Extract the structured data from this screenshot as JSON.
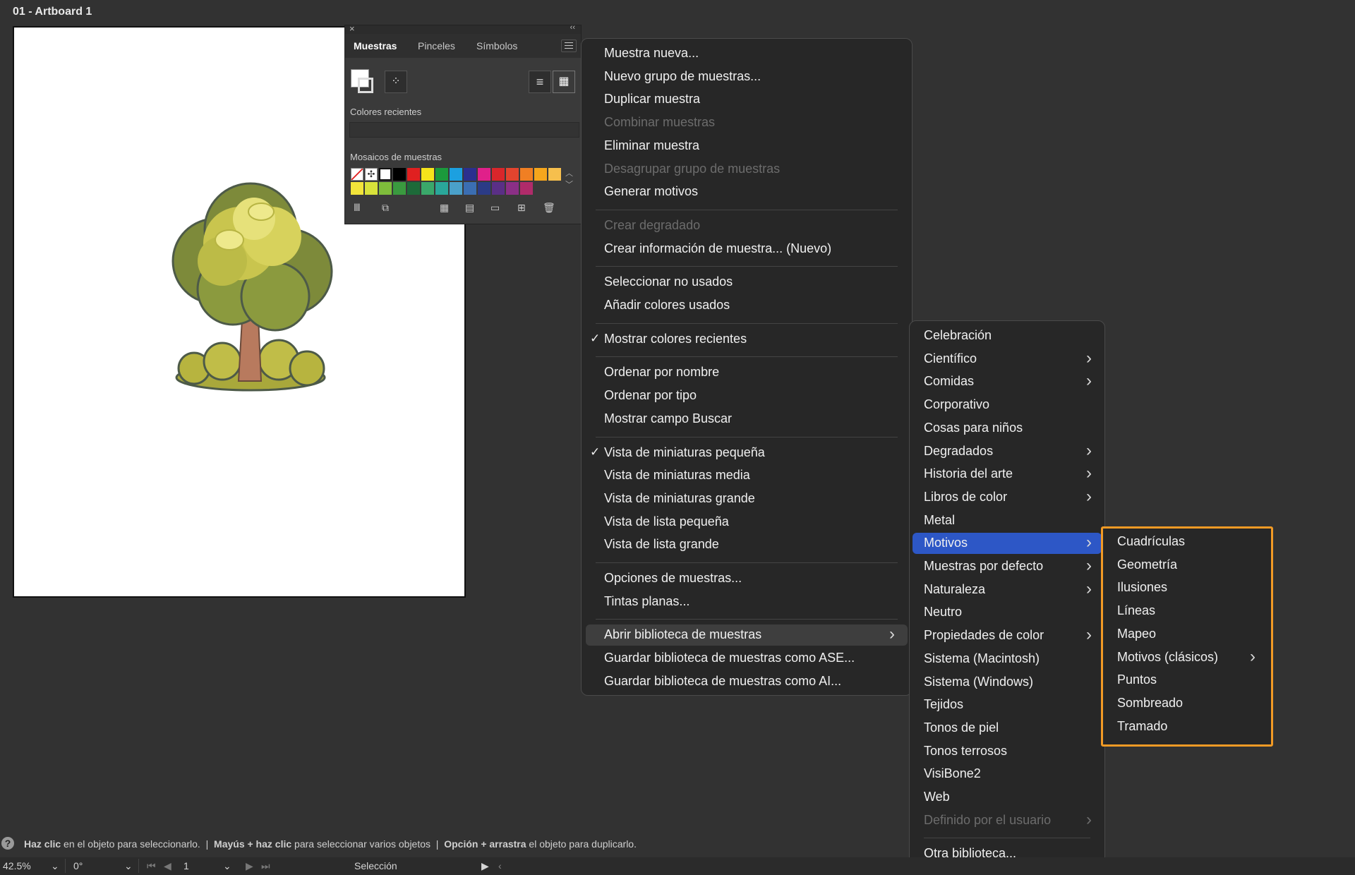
{
  "artboard": {
    "title": "01 - Artboard 1"
  },
  "panel": {
    "tabs": [
      "Muestras",
      "Pinceles",
      "Símbolos"
    ],
    "recent_label": "Colores recientes",
    "tiles_label": "Mosaicos de muestras",
    "swatch_row1": [
      "#000000",
      "#e02020",
      "#f6e41b",
      "#1b9a3c",
      "#1ca0e0",
      "#2b2f8f",
      "#e0208a",
      "#d9262b",
      "#e3442e",
      "#f07f23",
      "#f6a61c",
      "#f6bf4d"
    ],
    "swatch_row2": [
      "#f2e43a",
      "#d8e23a",
      "#7ebc3b",
      "#3a9a3f",
      "#1d6a39",
      "#3aa86a",
      "#2aa79a",
      "#4aa0c9",
      "#3b6eb2",
      "#2b3b86",
      "#5a2f86",
      "#8b2f86",
      "#b02b6a"
    ]
  },
  "main_menu": {
    "items": [
      {
        "label": "Muestra nueva...",
        "disabled": false
      },
      {
        "label": "Nuevo grupo de muestras...",
        "disabled": false
      },
      {
        "label": "Duplicar muestra",
        "disabled": false
      },
      {
        "label": "Combinar muestras",
        "disabled": true
      },
      {
        "label": "Eliminar muestra",
        "disabled": false
      },
      {
        "label": "Desagrupar grupo de muestras",
        "disabled": true
      },
      {
        "label": "Generar motivos",
        "disabled": false
      },
      {
        "label": "Crear degradado",
        "disabled": true
      },
      {
        "label": "Crear información de muestra... (Nuevo)",
        "disabled": false
      },
      {
        "label": "Seleccionar no usados",
        "disabled": false
      },
      {
        "label": "Añadir colores usados",
        "disabled": false
      },
      {
        "label": "Mostrar colores recientes",
        "checked": true
      },
      {
        "label": "Ordenar por nombre"
      },
      {
        "label": "Ordenar por tipo"
      },
      {
        "label": "Mostrar campo Buscar"
      },
      {
        "label": "Vista de miniaturas pequeña",
        "checked": true
      },
      {
        "label": "Vista de miniaturas media"
      },
      {
        "label": "Vista de miniaturas grande"
      },
      {
        "label": "Vista de lista pequeña"
      },
      {
        "label": "Vista de lista grande"
      },
      {
        "label": "Opciones de muestras..."
      },
      {
        "label": "Tintas planas..."
      },
      {
        "label": "Abrir biblioteca de muestras",
        "submenu": true,
        "highlighted": true
      },
      {
        "label": "Guardar biblioteca de muestras como ASE..."
      },
      {
        "label": "Guardar biblioteca de muestras como AI..."
      }
    ]
  },
  "library_menu": {
    "items": [
      {
        "label": "Celebración"
      },
      {
        "label": "Científico",
        "submenu": true
      },
      {
        "label": "Comidas",
        "submenu": true
      },
      {
        "label": "Corporativo"
      },
      {
        "label": "Cosas para niños"
      },
      {
        "label": "Degradados",
        "submenu": true
      },
      {
        "label": "Historia del arte",
        "submenu": true
      },
      {
        "label": "Libros de color",
        "submenu": true
      },
      {
        "label": "Metal"
      },
      {
        "label": "Motivos",
        "submenu": true,
        "selected": true
      },
      {
        "label": "Muestras por defecto",
        "submenu": true
      },
      {
        "label": "Naturaleza",
        "submenu": true
      },
      {
        "label": "Neutro"
      },
      {
        "label": "Propiedades de color",
        "submenu": true
      },
      {
        "label": "Sistema (Macintosh)"
      },
      {
        "label": "Sistema (Windows)"
      },
      {
        "label": "Tejidos"
      },
      {
        "label": "Tonos de piel"
      },
      {
        "label": "Tonos terrosos"
      },
      {
        "label": "VisiBone2"
      },
      {
        "label": "Web"
      },
      {
        "label": "Definido por el usuario",
        "submenu": true,
        "disabled": true
      },
      {
        "label": "Otra biblioteca..."
      }
    ]
  },
  "patterns_menu": {
    "items": [
      {
        "label": "Cuadrículas"
      },
      {
        "label": "Geometría"
      },
      {
        "label": "Ilusiones"
      },
      {
        "label": "Líneas"
      },
      {
        "label": "Mapeo"
      },
      {
        "label": "Motivos (clásicos)",
        "submenu": true
      },
      {
        "label": "Puntos"
      },
      {
        "label": "Sombreado"
      },
      {
        "label": "Tramado"
      }
    ]
  },
  "status": {
    "b1": "Haz clic",
    "t1": " en el objeto para seleccionarlo.  |  ",
    "b2": "Mayús + haz clic",
    "t2": " para seleccionar varios objetos  |  ",
    "b3": "Opción + arrastra",
    "t3": " el objeto para duplicarlo."
  },
  "bottom": {
    "zoom": "42.5%",
    "rotation": "0°",
    "artboard_num": "1",
    "tool": "Selección"
  },
  "colors": {
    "highlight": "#2d57c6",
    "callout": "#f29a25"
  }
}
